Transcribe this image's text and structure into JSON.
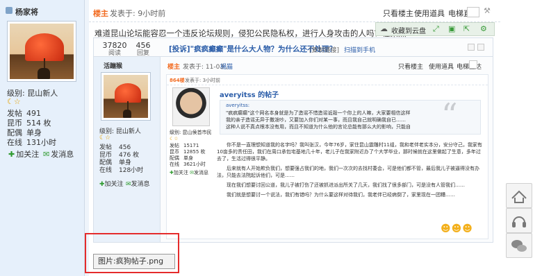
{
  "left": {
    "username": "杨家将",
    "level": "级别: 昆山新人",
    "stats": [
      {
        "key": "发帖",
        "value": "491"
      },
      {
        "key": "昆币",
        "value": "514 枚"
      },
      {
        "key": "配偶",
        "value": "单身"
      },
      {
        "key": "在线",
        "value": "131小时"
      }
    ],
    "follow": "加关注",
    "message": "发消息"
  },
  "post": {
    "badge": "楼主",
    "time": "发表于: 9小时前",
    "only_author": "只看楼主",
    "use_tool": "使用道具",
    "phone_direct": "电梯直达",
    "title": "难道昆山论坛能容忍一个违反论坛规则，侵犯公民隐私权，进行人身攻击的人吗？在聚焦",
    "cloud_save": "收藏到云盘"
  },
  "inner": {
    "views": "37820",
    "views_label": "阅读",
    "replies": "456",
    "replies_label": "回复",
    "title": "[投诉]\"疯疯癫癫\"是什么大人物？为什么还不处理？",
    "copy_link": "[复制链接]",
    "scan": "扫描到手机",
    "username": "活蹦猴",
    "badge": "楼主",
    "time": "发表于: 11-03 ,",
    "author": "楊猫",
    "only_author": "只看楼主",
    "use_tool": "使用道具",
    "phone_direct": "电梯直达",
    "level": "级别: 昆山新人",
    "stats": [
      {
        "key": "发帖",
        "value": "456"
      },
      {
        "key": "昆币",
        "value": "476 枚"
      },
      {
        "key": "配偶",
        "value": "单身"
      },
      {
        "key": "在线",
        "value": "128小时"
      }
    ],
    "follow": "加关注",
    "message": "发消息",
    "nested": {
      "label": "864楼",
      "time": "发表于: 3小时前",
      "author_title": "averyitss 的帖子",
      "level": "级别: 昆山侯首市民",
      "stats": [
        {
          "key": "发帖",
          "value": "15171"
        },
        {
          "key": "昆币",
          "value": "12855 枚"
        },
        {
          "key": "配偶",
          "value": "单身"
        },
        {
          "key": "在线",
          "value": "3621小时"
        }
      ],
      "follow": "加关注",
      "message": "发消息",
      "quote_author": "averyitss:",
      "quote_lines": [
        "\"疯疯癫癫\"这个网名本身就是为了造谣不惜造谣诋毁一个你上的人嘛，大家要相信这样",
        "我的亲子造谣无异于撒泼吵，又要加入你们对某一事，而且我自己就明确我自已……",
        "这种人说不真点根本没有用，而且不知道为什么他的言论总能有那么大的影响，只能自"
      ],
      "paragraphs": [
        "你不是一直理想知道我的名字吗？我叫张汉，今年76岁，家住昆山震雕村11组，我和老伴老实本分，安分守己，我家有10亩多的责任田，我们在周口承包宅基地几十年，老儿子在我家附近办了个大学毕业，那时候就在这里做起了生意，多年过去了，生活过得很平静。",
        "后来就有人开始欺负我们，想要强占我们的地，我们一次次的去找村委会，可是他们都不管，最后我儿子被逼得没有办法，只能去法院起诉他们，可是……",
        "现在我们想要讨回公道，我儿子被打伤了还被抓进派出所关了几天，我们找了很多部门，可是没有人管我们……",
        "我们就是想要讨一个说法，我们有错吗？为什么要这样对待我们，我老伴已经病倒了，家里现在一团糟……"
      ]
    }
  },
  "caption": "图片:疯狗帖子.png"
}
